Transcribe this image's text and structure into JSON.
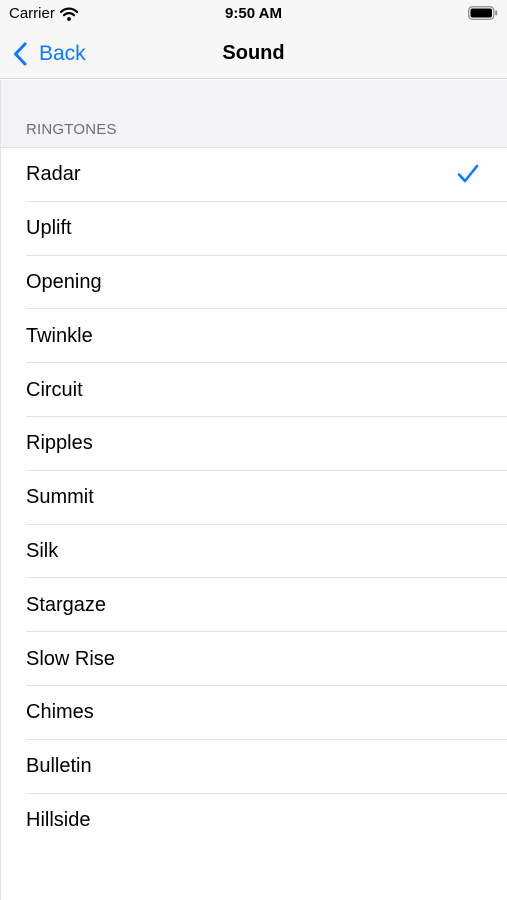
{
  "status_bar": {
    "carrier": "Carrier",
    "time": "9:50 AM",
    "icons": [
      "wifi-icon",
      "battery-icon"
    ]
  },
  "nav": {
    "back_label": "Back",
    "title": "Sound",
    "back_icon": "chevron-left-icon"
  },
  "section": {
    "header": "RINGTONES"
  },
  "ringtones": [
    {
      "label": "Radar",
      "selected": true
    },
    {
      "label": "Uplift",
      "selected": false
    },
    {
      "label": "Opening",
      "selected": false
    },
    {
      "label": "Twinkle",
      "selected": false
    },
    {
      "label": "Circuit",
      "selected": false
    },
    {
      "label": "Ripples",
      "selected": false
    },
    {
      "label": "Summit",
      "selected": false
    },
    {
      "label": "Silk",
      "selected": false
    },
    {
      "label": "Stargaze",
      "selected": false
    },
    {
      "label": "Slow Rise",
      "selected": false
    },
    {
      "label": "Chimes",
      "selected": false
    },
    {
      "label": "Bulletin",
      "selected": false
    },
    {
      "label": "Hillside",
      "selected": false
    }
  ],
  "colors": {
    "accent": "#0a7aff",
    "bar_background": "#f7f7f7",
    "grouped_background": "#f2f2f7",
    "separator": "#e3e3e6"
  }
}
